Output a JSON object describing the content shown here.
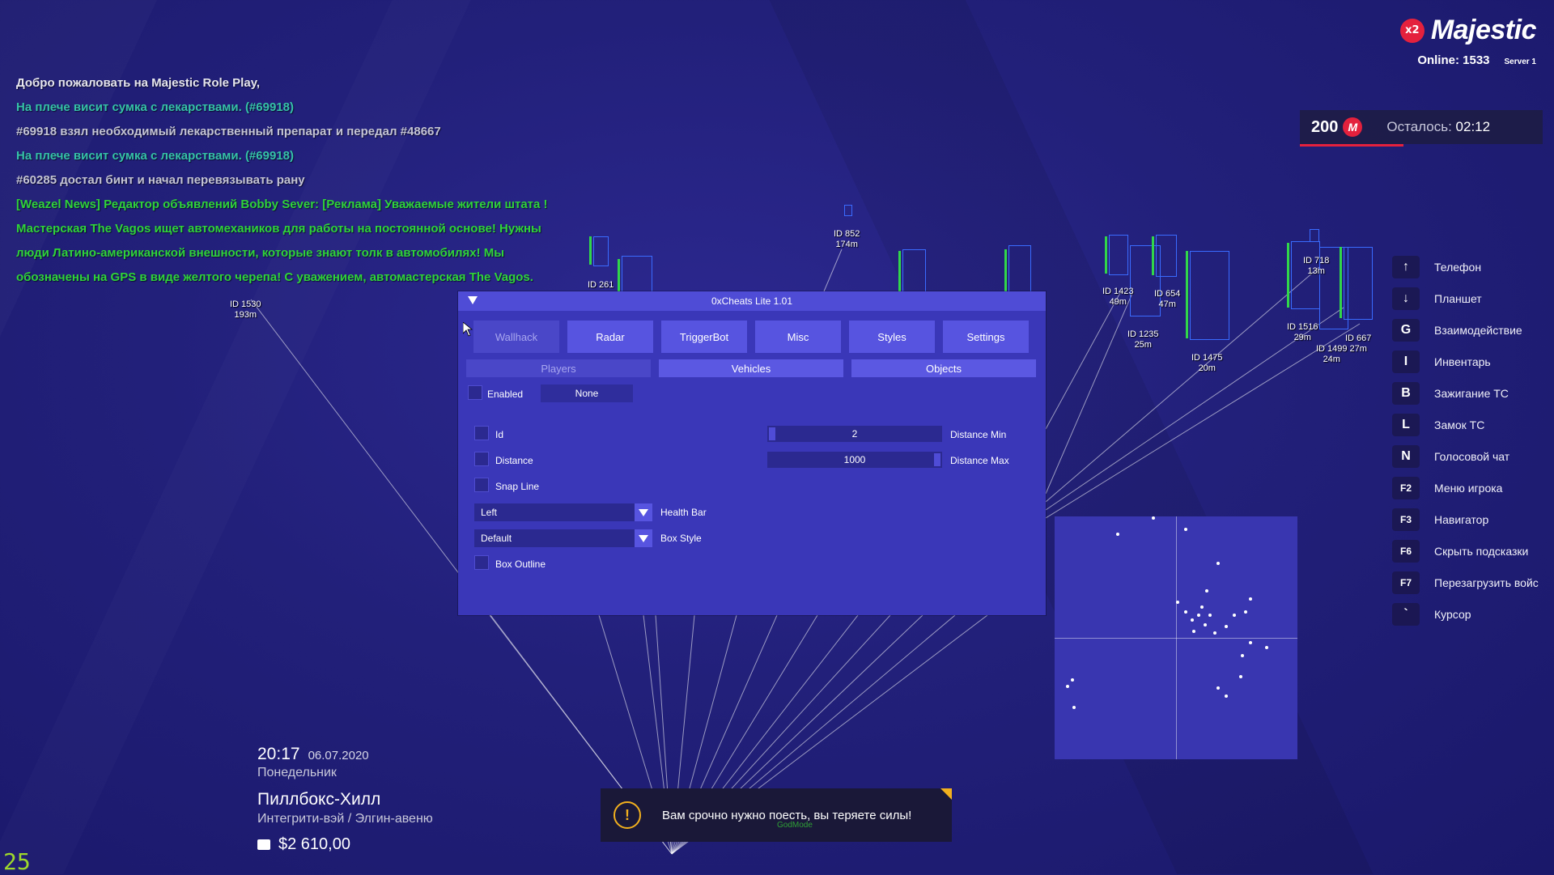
{
  "brand": {
    "badge": "x2",
    "name": "Majestic",
    "online": "Online: 1533",
    "server": "Server 1"
  },
  "timer": {
    "points": "200",
    "coin_symbol": "M",
    "remaining_label": "Осталось:",
    "remaining_time": "02:12"
  },
  "chat": [
    {
      "text": "Добро пожаловать на Majestic Role Play,",
      "color": "white"
    },
    {
      "text": "На плече висит сумка с лекарствами. (#69918)",
      "color": "teal"
    },
    {
      "text": "#69918 взял необходимый лекарственный препарат и передал #48667",
      "color": "gray"
    },
    {
      "text": "На плече висит сумка с лекарствами. (#69918)",
      "color": "teal"
    },
    {
      "text": "#60285 достал бинт и начал перевязывать рану",
      "color": "gray"
    },
    {
      "text": "[Weazel News] Редактор объявлений Bobby Sever: [Реклама] Уважаемые жители штата !",
      "color": "green"
    },
    {
      "text": "Мастерская The Vagos ищет автомехаников для работы на постоянной основе! Нужны",
      "color": "green"
    },
    {
      "text": "люди Латино-американской внешности, которые знают толк в автомобилях! Мы",
      "color": "green"
    },
    {
      "text": "обозначены на GPS в виде желтого черепа! С уважением, автомастерская The Vagos.",
      "color": "green"
    }
  ],
  "esp": [
    {
      "id": "ID 1530",
      "dist": "193m"
    },
    {
      "id": "ID 261",
      "dist": ""
    },
    {
      "id": "ID 852",
      "dist": "174m"
    },
    {
      "id": "ID 1423",
      "dist": "49m"
    },
    {
      "id": "ID 654",
      "dist": "47m"
    },
    {
      "id": "ID 1235",
      "dist": "25m"
    },
    {
      "id": "ID 1475",
      "dist": "20m"
    },
    {
      "id": "ID 718",
      "dist": "13m"
    },
    {
      "id": "ID 1516",
      "dist": "29m"
    },
    {
      "id": "ID 1499",
      "dist": "24m"
    },
    {
      "id": "ID 667",
      "dist": "27m"
    }
  ],
  "cheat": {
    "title": "0xCheats Lite 1.01",
    "tabs": [
      "Wallhack",
      "Radar",
      "TriggerBot",
      "Misc",
      "Styles",
      "Settings"
    ],
    "active_tab": "Wallhack",
    "subtabs": [
      "Players",
      "Vehicles",
      "Objects"
    ],
    "active_subtab": "Players",
    "enabled_label": "Enabled",
    "enabled_key": "None",
    "options": {
      "id": "Id",
      "distance": "Distance",
      "snap_line": "Snap Line",
      "box_outline": "Box Outline"
    },
    "distance_min": {
      "value": "2",
      "label": "Distance Min"
    },
    "distance_max": {
      "value": "1000",
      "label": "Distance Max"
    },
    "health_bar": {
      "value": "Left",
      "label": "Health Bar"
    },
    "box_style": {
      "value": "Default",
      "label": "Box Style"
    }
  },
  "keybinds": [
    {
      "key": "↑",
      "label": "Телефон"
    },
    {
      "key": "↓",
      "label": "Планшет"
    },
    {
      "key": "G",
      "label": "Взаимодействие"
    },
    {
      "key": "I",
      "label": "Инвентарь"
    },
    {
      "key": "B",
      "label": "Зажигание ТС"
    },
    {
      "key": "L",
      "label": "Замок ТС"
    },
    {
      "key": "N",
      "label": "Голосовой чат"
    },
    {
      "key": "F2",
      "label": "Меню игрока"
    },
    {
      "key": "F3",
      "label": "Навигатор"
    },
    {
      "key": "F6",
      "label": "Скрыть подсказки"
    },
    {
      "key": "F7",
      "label": "Перезагрузить войс"
    },
    {
      "key": "`",
      "label": "Курсор"
    }
  ],
  "hud": {
    "time": "20:17",
    "date": "06.07.2020",
    "day": "Понедельник",
    "location": "Пиллбокс-Хилл",
    "street": "Интегрити-вэй / Элгин-авеню",
    "money": "$2 610,00",
    "fps": "25"
  },
  "notification": {
    "icon": "!",
    "message": "Вам срочно нужно поесть, вы теряете силы!",
    "subtext": "GodMode"
  },
  "colors": {
    "accent": "#e4213d",
    "window": "#3a37b8",
    "esp_box": "#3a6bff",
    "health": "#31d64a",
    "chat_green": "#2fd33a"
  }
}
